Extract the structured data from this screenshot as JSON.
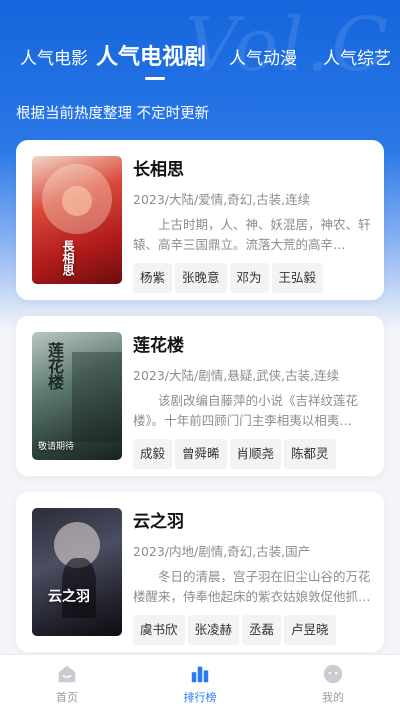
{
  "header": {
    "watermark": "Vol.C",
    "tabs": [
      {
        "label": "人气电影",
        "active": false
      },
      {
        "label": "人气电视剧",
        "active": true
      },
      {
        "label": "人气动漫",
        "active": false
      },
      {
        "label": "人气综艺",
        "active": false
      }
    ],
    "subtitle": "根据当前热度整理 不定时更新"
  },
  "colors": {
    "accent": "#2b7bf0",
    "header_top": "#1565dd",
    "background": "#f3f5f9"
  },
  "shows": [
    {
      "title": "长相思",
      "meta": "2023/大陆/爱情,奇幻,古装,连续",
      "description": "上古时期，人、神、妖混居，神农、轩辕、高辛三国鼎立。流落大荒的高辛…",
      "actors": [
        "杨紫",
        "张晚意",
        "邓为",
        "王弘毅"
      ],
      "poster_text": "長相思"
    },
    {
      "title": "莲花楼",
      "meta": "2023/大陆/剧情,悬疑,武侠,古装,连续",
      "description": "该剧改编自藤萍的小说《吉祥纹莲花楼》。十年前四顾门门主李相夷以相夷…",
      "actors": [
        "成毅",
        "曾舜晞",
        "肖顺尧",
        "陈都灵"
      ],
      "poster_text": "莲花楼",
      "poster_badge": "敬请期待"
    },
    {
      "title": "云之羽",
      "meta": "2023/内地/剧情,奇幻,古装,国产",
      "description": "冬日的清晨，宫子羽在旧尘山谷的万花楼醒来，侍奉他起床的紫衣姑娘敦促他抓…",
      "actors": [
        "虞书欣",
        "张凌赫",
        "丞磊",
        "卢昱晓"
      ],
      "poster_text": "云之羽"
    }
  ],
  "bottom_nav": [
    {
      "label": "首页",
      "icon": "home-icon",
      "active": false
    },
    {
      "label": "排行榜",
      "icon": "chart-icon",
      "active": true
    },
    {
      "label": "我的",
      "icon": "profile-icon",
      "active": false
    }
  ]
}
